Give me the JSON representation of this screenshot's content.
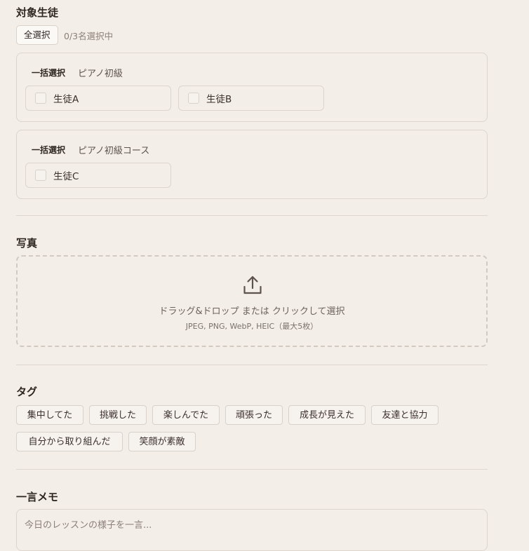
{
  "students": {
    "title": "対象生徒",
    "select_all": "全選択",
    "count": "0/3名選択中",
    "groups": [
      {
        "bulk_label": "一括選択",
        "course": "ピアノ初級",
        "students": [
          {
            "name": "生徒A",
            "checked": false
          },
          {
            "name": "生徒B",
            "checked": false
          }
        ]
      },
      {
        "bulk_label": "一括選択",
        "course": "ピアノ初級コース",
        "students": [
          {
            "name": "生徒C",
            "checked": false
          }
        ]
      }
    ]
  },
  "photo": {
    "title": "写真",
    "icon": "upload-icon",
    "drop_text": "ドラッグ&ドロップ または クリックして選択",
    "formats": "JPEG, PNG, WebP, HEIC（最大5枚）"
  },
  "tags": {
    "title": "タグ",
    "items": [
      "集中してた",
      "挑戦した",
      "楽しんでた",
      "頑張った",
      "成長が見えた",
      "友達と協力",
      "自分から取り組んだ",
      "笑顔が素敵"
    ]
  },
  "memo": {
    "title": "一言メモ",
    "placeholder": "今日のレッスンの様子を一言...",
    "value": ""
  }
}
